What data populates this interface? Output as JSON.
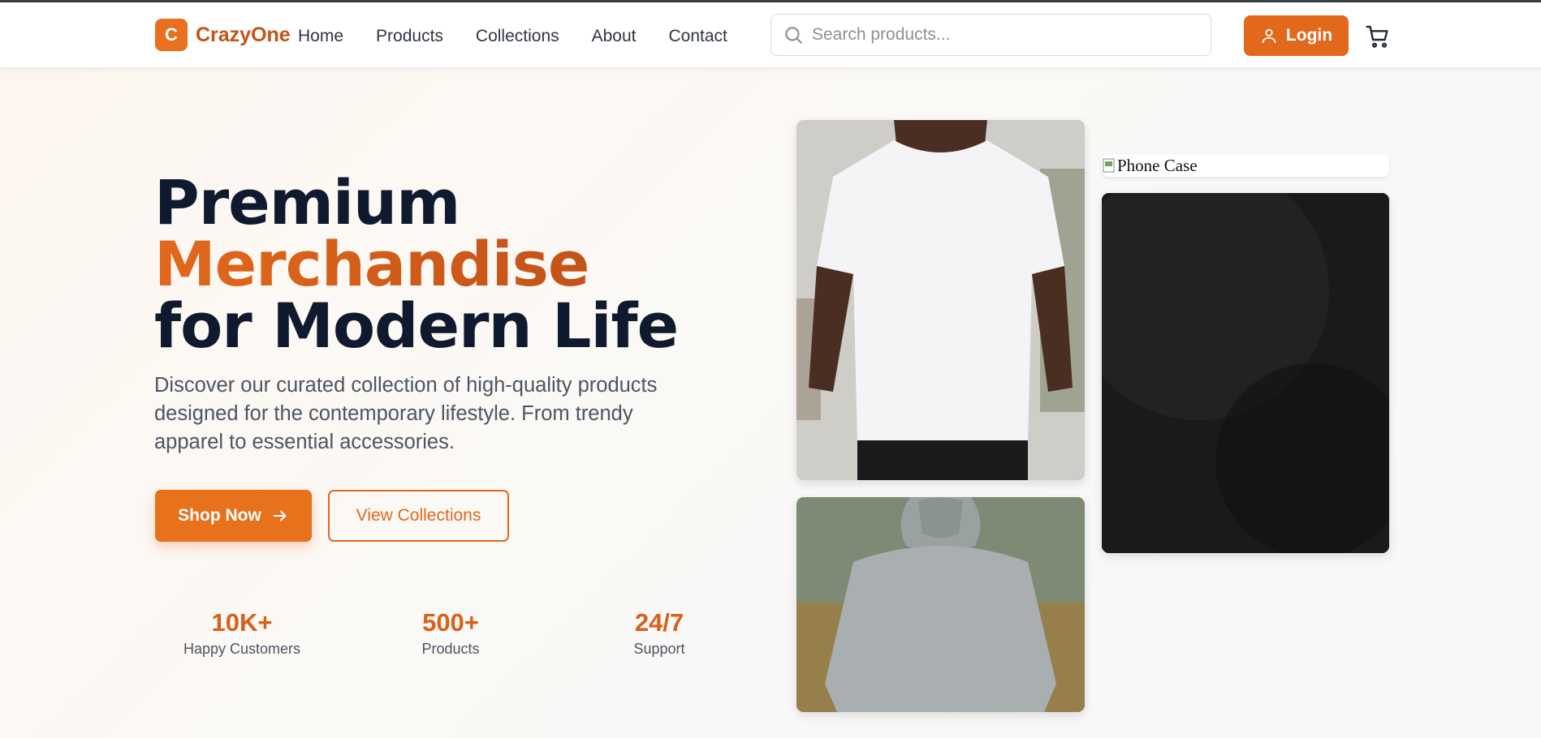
{
  "brand": {
    "logo_letter": "C",
    "name": "CrazyOne",
    "accent_color": "#e2681c"
  },
  "nav": {
    "items": [
      "Home",
      "Products",
      "Collections",
      "About",
      "Contact"
    ]
  },
  "search": {
    "placeholder": "Search products...",
    "value": ""
  },
  "header": {
    "login_label": "Login"
  },
  "hero": {
    "title_line1": "Premium",
    "title_line2": "Merchandise",
    "title_line3": "for Modern Life",
    "description": "Discover our curated collection of high-quality products designed for the contemporary lifestyle. From trendy apparel to essential accessories.",
    "primary_cta": "Shop Now",
    "secondary_cta": "View Collections"
  },
  "stats": [
    {
      "value": "10K+",
      "label": "Happy Customers"
    },
    {
      "value": "500+",
      "label": "Products"
    },
    {
      "value": "24/7",
      "label": "Support"
    }
  ],
  "gallery": {
    "broken_image_alt": "Phone Case"
  },
  "icons": [
    "logo-mark",
    "search-icon",
    "user-icon",
    "cart-icon",
    "arrow-right-icon",
    "broken-image-icon"
  ]
}
